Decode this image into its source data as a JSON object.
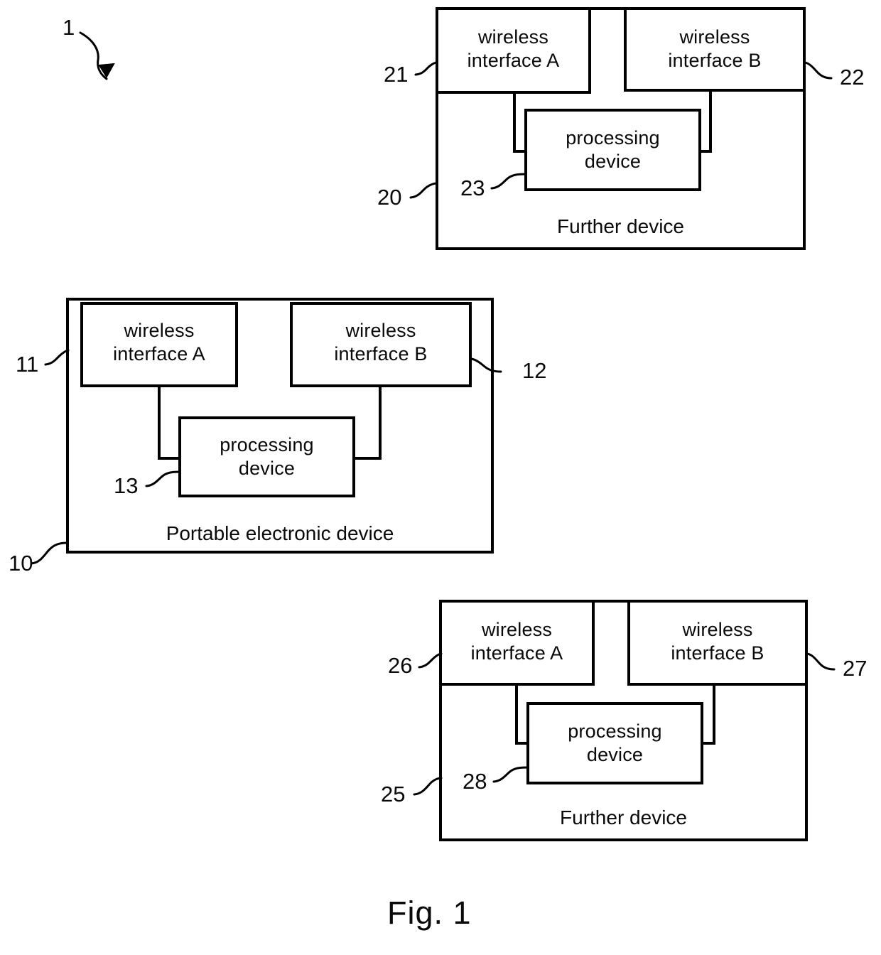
{
  "figure": {
    "caption": "Fig. 1",
    "figure_ref": "1"
  },
  "devices": [
    {
      "id": "further-device-top",
      "caption": "Further device",
      "container_ref": "20",
      "interface_a": {
        "label": "wireless\ninterface A",
        "ref": "21"
      },
      "interface_b": {
        "label": "wireless\ninterface B",
        "ref": "22"
      },
      "processing": {
        "label": "processing\ndevice",
        "ref": "23"
      }
    },
    {
      "id": "portable-electronic-device",
      "caption": "Portable electronic device",
      "container_ref": "10",
      "interface_a": {
        "label": "wireless\ninterface A",
        "ref": "11"
      },
      "interface_b": {
        "label": "wireless\ninterface B",
        "ref": "12"
      },
      "processing": {
        "label": "processing\ndevice",
        "ref": "13"
      }
    },
    {
      "id": "further-device-bottom",
      "caption": "Further device",
      "container_ref": "25",
      "interface_a": {
        "label": "wireless\ninterface A",
        "ref": "26"
      },
      "interface_b": {
        "label": "wireless\ninterface B",
        "ref": "27"
      },
      "processing": {
        "label": "processing\ndevice",
        "ref": "28"
      }
    }
  ],
  "colors": {
    "line": "#000000",
    "background": "#ffffff",
    "text": "#0a0a0a"
  }
}
